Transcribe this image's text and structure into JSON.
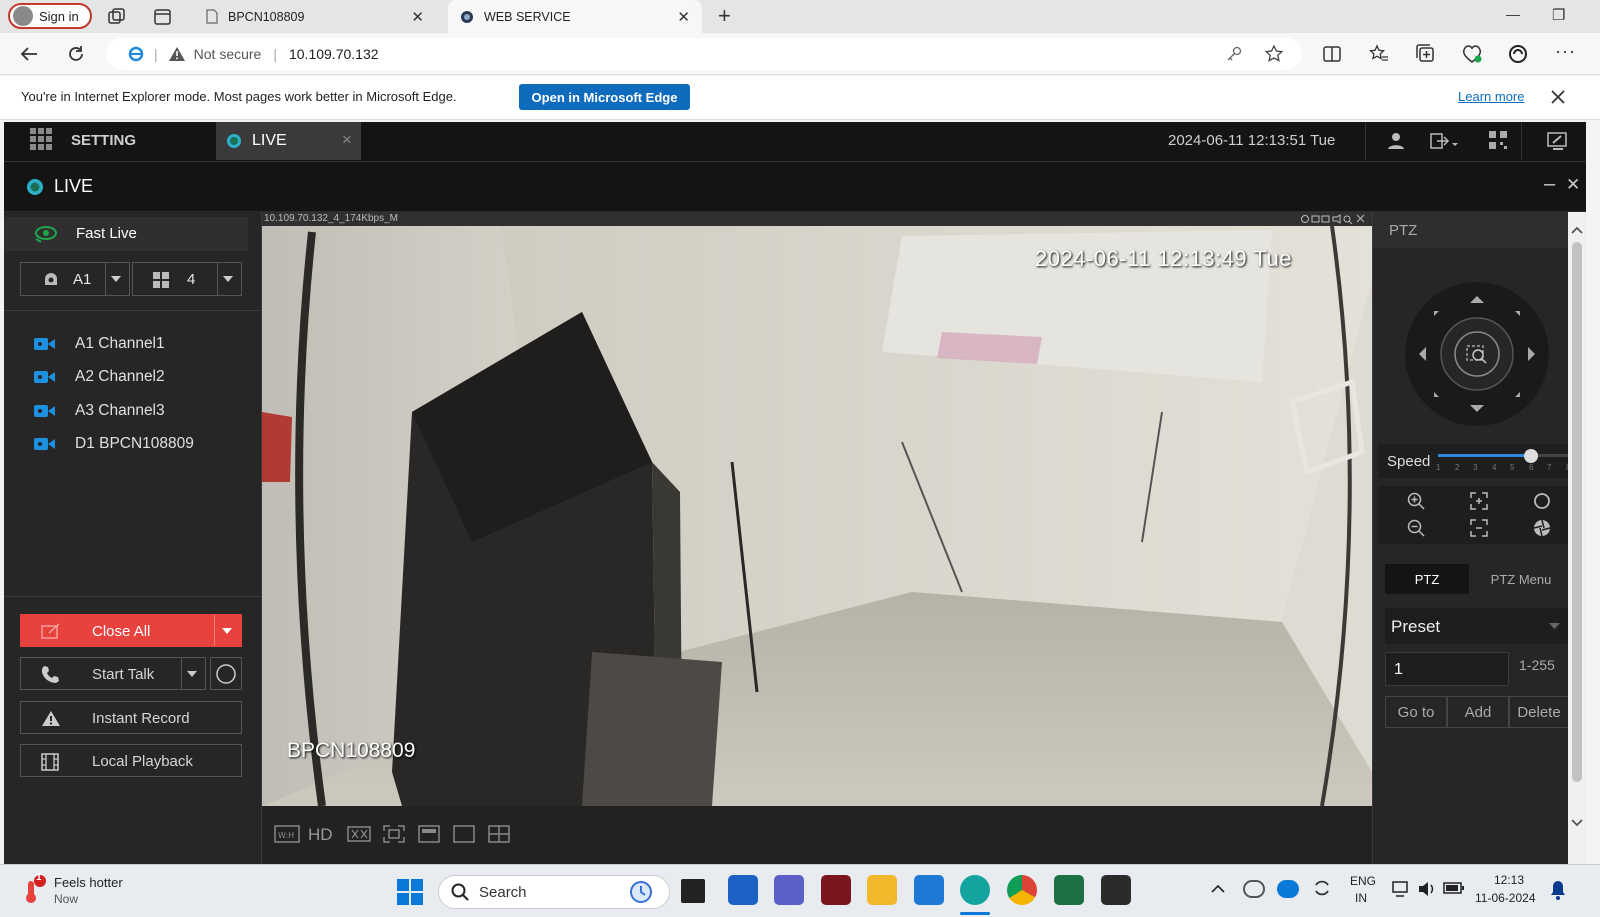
{
  "browser": {
    "signin_label": "Sign in",
    "tabs": [
      {
        "title": "BPCN108809",
        "close": "✕"
      },
      {
        "title": "WEB SERVICE",
        "close": "✕"
      }
    ],
    "new_tab": "+",
    "security_label": "Not secure",
    "url": "10.109.70.132",
    "ie_notice": "You're in Internet Explorer mode. Most pages work better in Microsoft Edge.",
    "open_edge_label": "Open in Microsoft Edge",
    "learn_more": "Learn more",
    "window_controls": {
      "minimize": "—",
      "restore": "❐"
    }
  },
  "app": {
    "nav": {
      "setting_label": "SETTING",
      "live_tab_label": "LIVE",
      "live_tab_close": "×",
      "datetime": "2024-06-11 12:13:51 Tue"
    },
    "live_header": {
      "title": "LIVE",
      "minimize": "–",
      "close": "✕"
    },
    "left": {
      "fast_live": "Fast Live",
      "channel_select": "A1",
      "split_select": "4",
      "channels": [
        {
          "label": "A1 Channel1"
        },
        {
          "label": "A2 Channel2"
        },
        {
          "label": "A3 Channel3"
        },
        {
          "label": "D1 BPCN108809"
        }
      ],
      "close_all": "Close All",
      "start_talk": "Start Talk",
      "instant_record": "Instant Record",
      "local_playback": "Local Playback"
    },
    "video": {
      "stream_info": "10.109.70.132_4_174Kbps_M",
      "osd_time": "2024-06-11 12:13:49 Tue",
      "osd_name": "BPCN108809",
      "toolbar_hd": "HD"
    },
    "ptz": {
      "title": "PTZ",
      "speed_label": "Speed",
      "speed_ticks": [
        "1",
        "2",
        "3",
        "4",
        "5",
        "6",
        "7",
        "8"
      ],
      "speed_value": 6,
      "tab_ptz": "PTZ",
      "tab_menu": "PTZ Menu",
      "preset_label": "Preset",
      "preset_value": "1",
      "preset_range": "1-255",
      "goto_label": "Go to",
      "add_label": "Add",
      "delete_label": "Delete"
    }
  },
  "taskbar": {
    "weather_title": "Feels hotter",
    "weather_sub": "Now",
    "weather_badge": "1",
    "search_label": "Search",
    "lang_1": "ENG",
    "lang_2": "IN",
    "time": "12:13",
    "date": "11-06-2024"
  },
  "colors": {
    "accent_red": "#e8423f",
    "edge_blue": "#0f6cbd",
    "camera_blue": "#1e90e0",
    "fast_live_green": "#1fa64a"
  }
}
